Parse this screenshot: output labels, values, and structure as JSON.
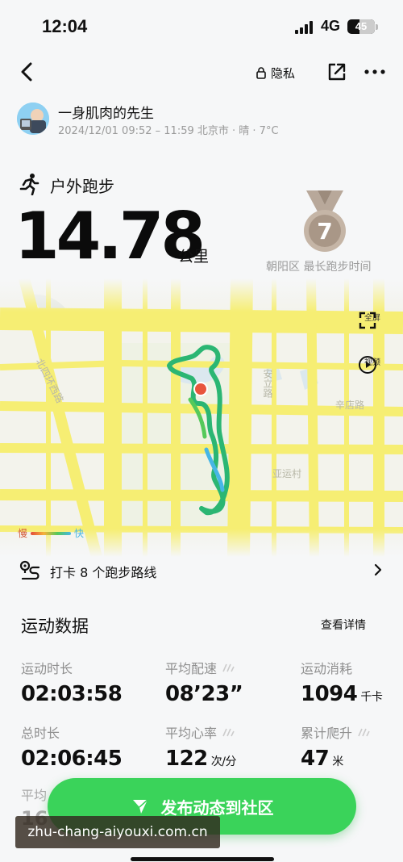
{
  "status_bar": {
    "time": "12:04",
    "network": "4G",
    "battery": "45",
    "battery_level": 0.45
  },
  "nav": {
    "privacy_label": "隐私"
  },
  "user": {
    "name": "一身肌肉的先生",
    "meta": "2024/12/01 09:52 – 11:59 北京市 · 晴 · 7°C"
  },
  "activity": {
    "type": "户外跑步",
    "distance": "14.78",
    "distance_unit": "公里",
    "medal_number": "7",
    "medal_caption": "朝阳区 最长跑步时间"
  },
  "map": {
    "labels": [
      "安立路",
      "辛店路",
      "亚运村",
      "北四环西路"
    ],
    "fullscreen_label": "全屏",
    "video_label": "视频",
    "legend_slow": "慢",
    "legend_fast": "快",
    "route_colors": [
      "#2bb673",
      "#46b6e6",
      "#54c95a"
    ],
    "start_color": "#e8553c"
  },
  "checkin": {
    "text": "打卡 8 个跑步路线"
  },
  "stats": {
    "title": "运动数据",
    "details_label": "查看详情",
    "items": [
      {
        "label": "运动时长",
        "value": "02:03:58",
        "unit": ""
      },
      {
        "label": "平均配速",
        "value": "08’23”",
        "unit": ""
      },
      {
        "label": "运动消耗",
        "value": "1094",
        "unit": "千卡"
      },
      {
        "label": "总时长",
        "value": "02:06:45",
        "unit": ""
      },
      {
        "label": "平均心率",
        "value": "122",
        "unit": "次/分"
      },
      {
        "label": "累计爬升",
        "value": "47",
        "unit": "米"
      }
    ],
    "peek_label": "平均",
    "peek_value": "16"
  },
  "publish": {
    "label": "发布动态到社区"
  },
  "watermark": "zhu-chang-aiyouxi.com.cn",
  "colors": {
    "accent_green": "#3ad35a",
    "map_road": "#f6ee73",
    "medal": "#b8a89a"
  }
}
